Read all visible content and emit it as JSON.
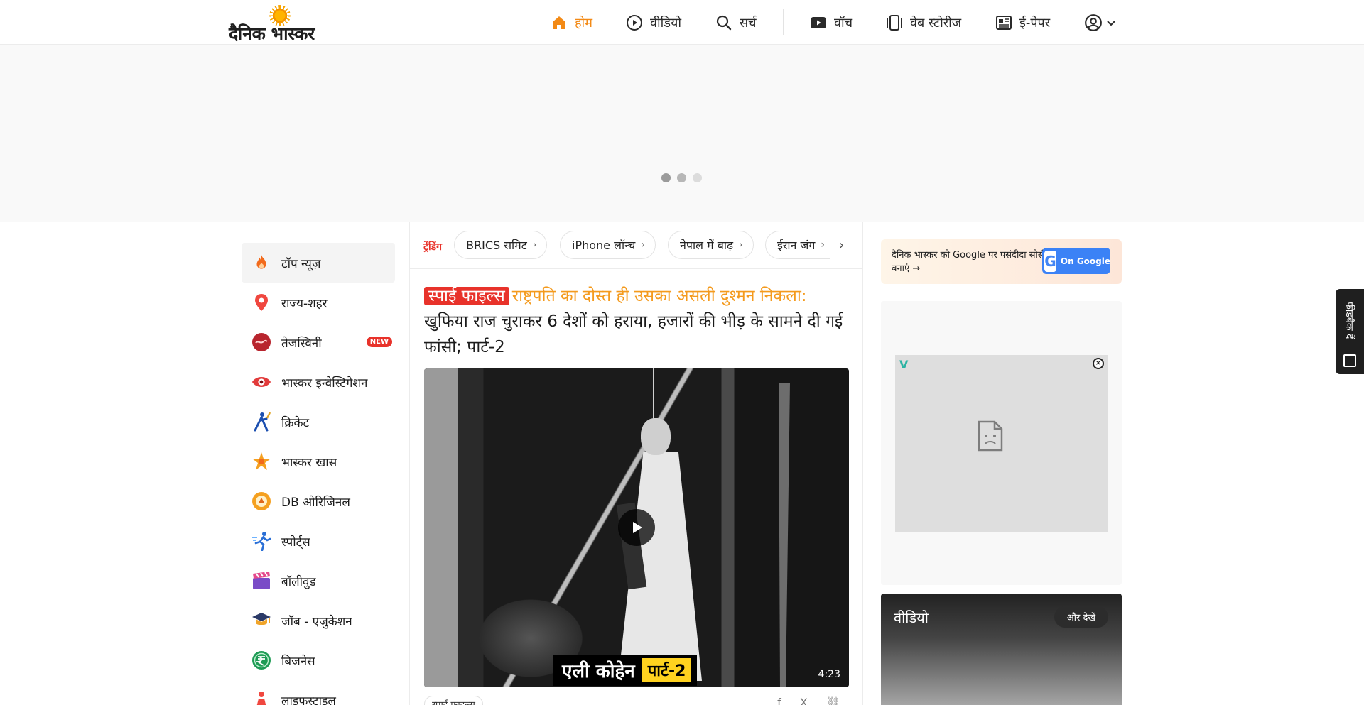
{
  "header": {
    "logo_text": "दैनिक भास्कर",
    "nav": [
      {
        "label": "होम",
        "icon": "home-icon"
      },
      {
        "label": "वीडियो",
        "icon": "play-circle-icon"
      },
      {
        "label": "सर्च",
        "icon": "search-icon"
      },
      {
        "label": "वॉच",
        "icon": "youtube-icon"
      },
      {
        "label": "वेब स्टोरीज",
        "icon": "web-stories-icon"
      },
      {
        "label": "ई-पेपर",
        "icon": "newspaper-icon"
      }
    ],
    "account_icon": "user-circle-icon"
  },
  "sidebar": {
    "items": [
      {
        "label": "टॉप न्यूज़",
        "icon": "fire-icon"
      },
      {
        "label": "राज्य-शहर",
        "icon": "location-pin-icon"
      },
      {
        "label": "तेजस्विनी",
        "icon": "tejaswini-icon",
        "badge": "NEW"
      },
      {
        "label": "भास्कर इन्वेस्टिगेशन",
        "icon": "eye-icon"
      },
      {
        "label": "क्रिकेट",
        "icon": "cricket-icon"
      },
      {
        "label": "भास्कर खास",
        "icon": "star-burst-icon"
      },
      {
        "label": "DB ओरिजिनल",
        "icon": "db-original-icon"
      },
      {
        "label": "स्पोर्ट्स",
        "icon": "runner-icon"
      },
      {
        "label": "बॉलीवुड",
        "icon": "clapper-icon"
      },
      {
        "label": "जॉब - एजुकेशन",
        "icon": "graduation-cap-icon"
      },
      {
        "label": "बिजनेस",
        "icon": "rupee-icon"
      },
      {
        "label": "लाइफस्टाइल",
        "icon": "lifestyle-icon"
      }
    ]
  },
  "trending": {
    "label": "ट्रेंडिंग",
    "chips": [
      "BRICS समिट",
      "iPhone लॉन्च",
      "नेपाल में बाढ़",
      "ईरान जंग"
    ]
  },
  "story": {
    "tag": "स्पाई फाइल्स",
    "headline_orange": "राष्ट्रपति का दोस्त ही उसका असली दुश्मन निकला:",
    "headline_rest": "खुफिया राज चुराकर 6 देशों को हराया, हजारों की भीड़ के सामने दी गई फांसी; पार्ट-2",
    "video_caption_name": "एली कोहेन",
    "video_caption_part": "पार्ट-2",
    "duration": "4:23",
    "series_chip": "स्पाई फाइल्स"
  },
  "right": {
    "google_text": "दैनिक भास्कर को Google पर पसंदीदा सोर्स बनाएं →",
    "google_button": "On Google",
    "video_title": "वीडियो",
    "video_more": "और देखें"
  },
  "feedback": {
    "label": "फीडबैक दें"
  },
  "colors": {
    "accent": "#f38a16",
    "tag_red": "#e8322a",
    "google_blue": "#3b82f6"
  }
}
